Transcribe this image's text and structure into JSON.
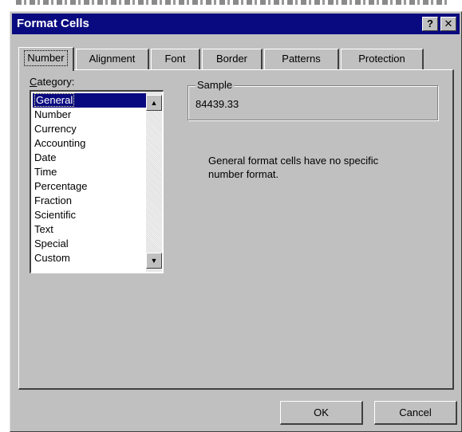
{
  "window": {
    "title": "Format Cells",
    "help_button": "?",
    "close_button": "✕"
  },
  "tabs": [
    {
      "label": "Number",
      "active": true
    },
    {
      "label": "Alignment",
      "active": false
    },
    {
      "label": "Font",
      "active": false
    },
    {
      "label": "Border",
      "active": false
    },
    {
      "label": "Patterns",
      "active": false
    },
    {
      "label": "Protection",
      "active": false
    }
  ],
  "category": {
    "label_underlined": "C",
    "label_rest": "ategory:",
    "items": [
      "General",
      "Number",
      "Currency",
      "Accounting",
      "Date",
      "Time",
      "Percentage",
      "Fraction",
      "Scientific",
      "Text",
      "Special",
      "Custom"
    ],
    "selected": "General"
  },
  "sample": {
    "legend": "Sample",
    "value": "84439.33"
  },
  "description": "General format cells have no specific number format.",
  "buttons": {
    "ok": "OK",
    "cancel": "Cancel"
  },
  "colors": {
    "titlebar": "#0a0a80",
    "face": "#c0c0c0",
    "selection": "#0a0a80"
  }
}
